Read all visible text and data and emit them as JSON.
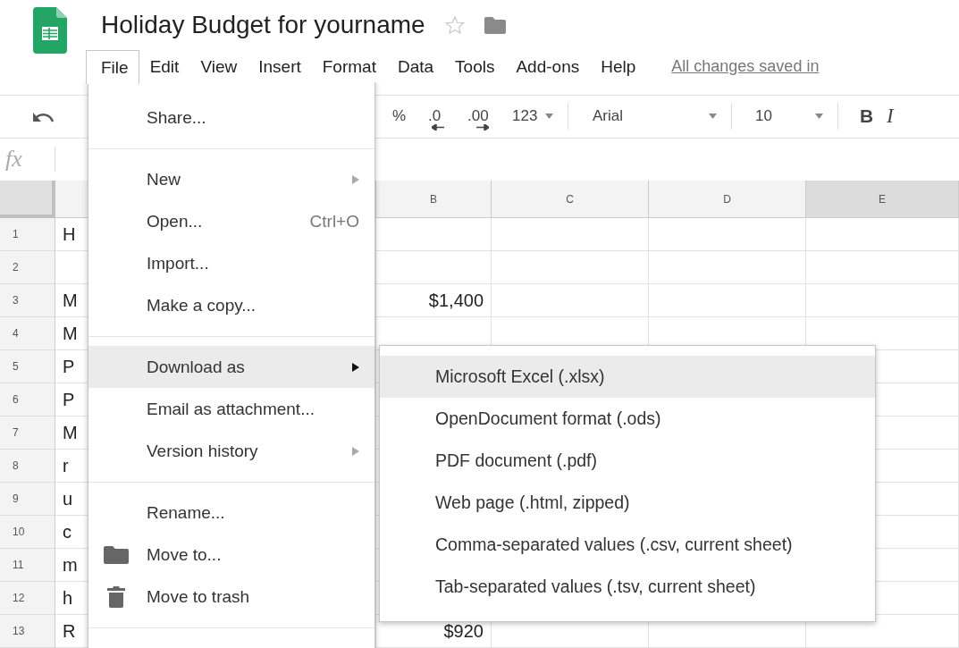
{
  "app": {
    "title": "Holiday Budget for yourname",
    "starred": false
  },
  "menu_bar": {
    "items": [
      {
        "label": "File",
        "selected": true
      },
      {
        "label": "Edit",
        "selected": false
      },
      {
        "label": "View",
        "selected": false
      },
      {
        "label": "Insert",
        "selected": false
      },
      {
        "label": "Format",
        "selected": false
      },
      {
        "label": "Data",
        "selected": false
      },
      {
        "label": "Tools",
        "selected": false
      },
      {
        "label": "Add-ons",
        "selected": false
      },
      {
        "label": "Help",
        "selected": false
      }
    ],
    "save_status": "All changes saved in"
  },
  "toolbar": {
    "items": [
      {
        "kind": "undo"
      },
      {
        "kind": "text",
        "label": "%"
      },
      {
        "kind": "decimal-decrease",
        "label": ".0"
      },
      {
        "kind": "decimal-increase",
        "label": ".00"
      },
      {
        "kind": "format-menu",
        "label": "123"
      },
      {
        "kind": "separator"
      },
      {
        "kind": "font-menu",
        "label": "Arial"
      },
      {
        "kind": "separator"
      },
      {
        "kind": "size-menu",
        "label": "10"
      },
      {
        "kind": "separator"
      },
      {
        "kind": "bold",
        "label": "B"
      },
      {
        "kind": "italic",
        "label": "I"
      }
    ]
  },
  "formula_bar": {
    "label": "fx"
  },
  "sheet": {
    "columns": [
      {
        "label": "B",
        "selected": false
      },
      {
        "label": "C",
        "selected": false
      },
      {
        "label": "D",
        "selected": false
      },
      {
        "label": "E",
        "selected": true
      }
    ],
    "rows": [
      {
        "number": "1",
        "column_a": "H",
        "column_b": ""
      },
      {
        "number": "2",
        "column_a": "",
        "column_b": ""
      },
      {
        "number": "3",
        "column_a": "M",
        "column_b": "$1,400"
      },
      {
        "number": "4",
        "column_a": "M",
        "column_b": ""
      },
      {
        "number": "5",
        "column_a": "P",
        "column_b": ""
      },
      {
        "number": "6",
        "column_a": "P",
        "column_b": ""
      },
      {
        "number": "7",
        "column_a": "M",
        "column_b": ""
      },
      {
        "number": "8",
        "column_a": "r",
        "column_b": ""
      },
      {
        "number": "9",
        "column_a": "u",
        "column_b": ""
      },
      {
        "number": "10",
        "column_a": "c",
        "column_b": ""
      },
      {
        "number": "11",
        "column_a": "m",
        "column_b": ""
      },
      {
        "number": "12",
        "column_a": "h",
        "column_b": ""
      },
      {
        "number": "13",
        "column_a": "R",
        "column_b": "$920"
      }
    ]
  },
  "file_menu": {
    "items": [
      {
        "kind": "item",
        "label": "Share...",
        "submenu": false,
        "selected": false
      },
      {
        "kind": "divider"
      },
      {
        "kind": "item",
        "label": "New",
        "submenu": true,
        "selected": false
      },
      {
        "kind": "item",
        "label": "Open...",
        "shortcut": "Ctrl+O",
        "submenu": false,
        "selected": false
      },
      {
        "kind": "item",
        "label": "Import...",
        "submenu": false,
        "selected": false
      },
      {
        "kind": "item",
        "label": "Make a copy...",
        "submenu": false,
        "selected": false
      },
      {
        "kind": "divider"
      },
      {
        "kind": "item",
        "label": "Download as",
        "submenu": true,
        "selected": true
      },
      {
        "kind": "item",
        "label": "Email as attachment...",
        "submenu": false,
        "selected": false
      },
      {
        "kind": "item",
        "label": "Version history",
        "submenu": true,
        "selected": false
      },
      {
        "kind": "divider"
      },
      {
        "kind": "item",
        "label": "Rename...",
        "submenu": false,
        "selected": false
      },
      {
        "kind": "folder-item",
        "label": "Move to...",
        "submenu": false,
        "selected": false
      },
      {
        "kind": "trash-item",
        "label": "Move to trash",
        "submenu": false,
        "selected": false
      },
      {
        "kind": "divider"
      }
    ]
  },
  "download_menu": {
    "items": [
      {
        "label": "Microsoft Excel (.xlsx)",
        "selected": true
      },
      {
        "label": "OpenDocument format (.ods)",
        "selected": false
      },
      {
        "label": "PDF document (.pdf)",
        "selected": false
      },
      {
        "label": "Web page (.html, zipped)",
        "selected": false
      },
      {
        "label": "Comma-separated values (.csv, current sheet)",
        "selected": false
      },
      {
        "label": "Tab-separated values (.tsv, current sheet)",
        "selected": false
      }
    ]
  }
}
